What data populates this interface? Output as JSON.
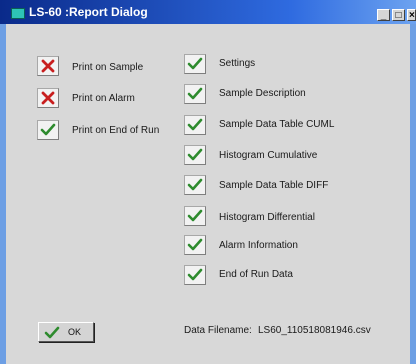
{
  "window": {
    "title": "LS-60 :Report Dialog",
    "minimize_glyph": "_",
    "maximize_glyph": "□",
    "close_glyph": "×"
  },
  "left_options": [
    {
      "label": "Print on Sample",
      "checked": false
    },
    {
      "label": "Print on Alarm",
      "checked": false
    },
    {
      "label": "Print on End of Run",
      "checked": true
    }
  ],
  "right_options": [
    {
      "label": "Settings",
      "checked": true
    },
    {
      "label": "Sample Description",
      "checked": true
    },
    {
      "label": "Sample Data Table CUML",
      "checked": true
    },
    {
      "label": "Histogram Cumulative",
      "checked": true
    },
    {
      "label": "Sample Data Table DIFF",
      "checked": true
    },
    {
      "label": "Histogram Differential",
      "checked": true
    },
    {
      "label": "Alarm Information",
      "checked": true
    },
    {
      "label": "End of Run Data",
      "checked": true
    }
  ],
  "ok_button": {
    "label": "OK",
    "icon": "checkmark-icon"
  },
  "filename": {
    "label": "Data Filename:",
    "value": "LS60_110518081946.csv"
  },
  "colors": {
    "check_green": "#2e8b2e",
    "cross_red": "#c81e1e",
    "titlebar": "#0a2a8a",
    "dialog_bg": "#d8d8d8"
  }
}
